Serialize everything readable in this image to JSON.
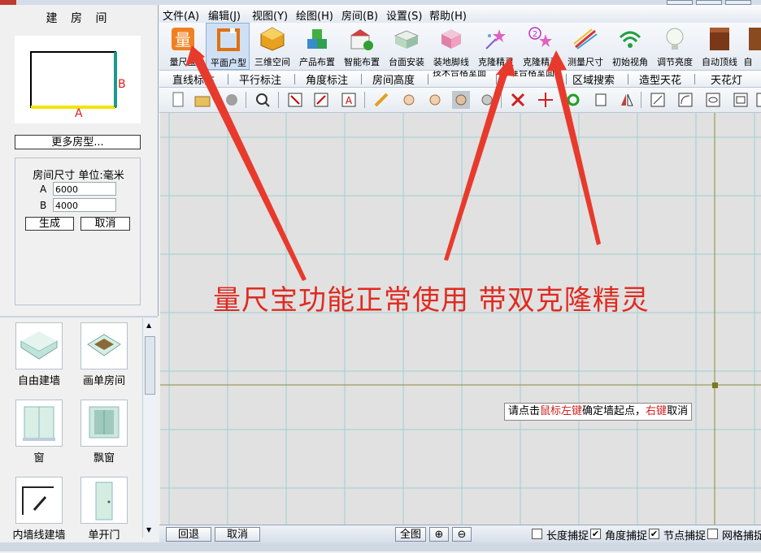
{
  "left_panel": {
    "title": "建 房 间",
    "preview": {
      "label_a": "A",
      "label_b": "B"
    },
    "more_types_button": "更多房型...",
    "size_label": "房间尺寸 单位:毫米",
    "field_a": {
      "label": "A",
      "value": "6000"
    },
    "field_b": {
      "label": "B",
      "value": "4000"
    },
    "generate_button": "生成",
    "cancel_button": "取消",
    "library": [
      {
        "label": "自由建墙",
        "icon": "free-wall-icon"
      },
      {
        "label": "画单房间",
        "icon": "single-room-icon"
      },
      {
        "label": "窗",
        "icon": "window-icon"
      },
      {
        "label": "飘窗",
        "icon": "bay-window-icon"
      },
      {
        "label": "内墙线建墙",
        "icon": "inner-wall-line-icon"
      },
      {
        "label": "单开门",
        "icon": "single-door-icon"
      }
    ]
  },
  "menu": [
    "文件(A)",
    "编辑(J)",
    "视图(Y)",
    "绘图(H)",
    "房间(B)",
    "设置(S)",
    "帮助(H)"
  ],
  "toolbar": [
    {
      "label": "量尺宝",
      "icon": "ruler-treasure-icon"
    },
    {
      "label": "平面户型",
      "icon": "floor-plan-icon"
    },
    {
      "label": "三维空间",
      "icon": "3d-space-icon"
    },
    {
      "label": "产品布置",
      "icon": "product-layout-icon"
    },
    {
      "label": "智能布置",
      "icon": "smart-layout-icon"
    },
    {
      "label": "台面安装",
      "icon": "countertop-icon"
    },
    {
      "label": "装地脚线",
      "icon": "baseboard-icon"
    },
    {
      "label": "克隆精灵",
      "icon": "clone-wizard-icon"
    },
    {
      "label": "克隆精灵",
      "icon": "clone-wizard-2-icon"
    },
    {
      "label": "测量尺寸",
      "icon": "measure-icon"
    },
    {
      "label": "初始视角",
      "icon": "initial-view-icon"
    },
    {
      "label": "调节亮度",
      "icon": "brightness-icon"
    },
    {
      "label": "自动顶线",
      "icon": "auto-top-line-icon"
    },
    {
      "label": "自",
      "icon": "auto-icon"
    }
  ],
  "tabs": [
    "直线标注",
    "平行标注",
    "角度标注",
    "房间高度",
    "技术合格室面",
    "标准合格室面",
    "区域搜索",
    "造型天花",
    "天花灯"
  ],
  "canvas": {
    "overlay_text": "量尺宝功能正常使用 带双克隆精灵",
    "tooltip": {
      "p1": "请点击",
      "p2": "鼠标左键",
      "p3": "确定墙起点，",
      "p4": "右键",
      "p5": "取消"
    }
  },
  "statusbar": {
    "undo": "回退",
    "cancel": "取消",
    "fullview": "全图",
    "checks": [
      "长度捕捉",
      "角度捕捉",
      "节点捕捉",
      "网格捕捉"
    ]
  },
  "colors": {
    "accent_red": "#e02a20",
    "grid_line": "#9fd0d0",
    "canvas_bg": "#e1e1e1",
    "crosshair": "#8a8a3a"
  }
}
